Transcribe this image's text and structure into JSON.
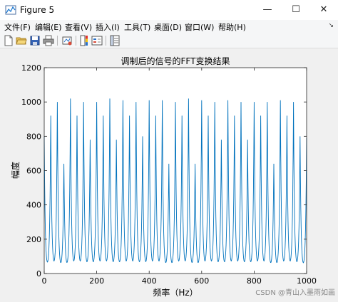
{
  "window": {
    "title": "Figure 5",
    "minimize": "—",
    "maximize": "☐",
    "close": "✕"
  },
  "menu": {
    "items": [
      {
        "label": "文件(F)"
      },
      {
        "label": "编辑(E)"
      },
      {
        "label": "查看(V)"
      },
      {
        "label": "插入(I)"
      },
      {
        "label": "工具(T)"
      },
      {
        "label": "桌面(D)"
      },
      {
        "label": "窗口(W)"
      },
      {
        "label": "帮助(H)"
      }
    ],
    "overflow_arrow": "↘"
  },
  "toolbar": {
    "icons": [
      "new-figure-icon",
      "open-file-icon",
      "save-icon",
      "print-icon",
      "link-plot-icon",
      "colorbar-icon",
      "legend-icon",
      "property-inspector-icon"
    ]
  },
  "chart_data": {
    "type": "line",
    "title": "调制后的信号的FFT变换结果",
    "xlabel": "频率（Hz）",
    "ylabel": "幅度",
    "xlim": [
      0,
      1000
    ],
    "ylim": [
      0,
      1200
    ],
    "xticks": [
      "0",
      "200",
      "400",
      "600",
      "800",
      "1000"
    ],
    "yticks": [
      "0",
      "200",
      "400",
      "600",
      "800",
      "1000",
      "1200"
    ],
    "grid": false,
    "line_color": "#0072bd",
    "peak_x": [
      0,
      25,
      50,
      75,
      100,
      125,
      150,
      175,
      200,
      225,
      250,
      275,
      300,
      325,
      350,
      375,
      400,
      425,
      450,
      475,
      500,
      525,
      550,
      575,
      600,
      625,
      650,
      675,
      700,
      725,
      750,
      775,
      800,
      825,
      850,
      875,
      900,
      925,
      950,
      975,
      1000
    ],
    "peak_y": [
      800,
      920,
      1000,
      640,
      1020,
      920,
      1000,
      780,
      1000,
      920,
      1020,
      780,
      1010,
      920,
      1000,
      800,
      1010,
      920,
      1010,
      640,
      1000,
      920,
      1020,
      640,
      1010,
      920,
      1000,
      780,
      1010,
      920,
      1000,
      780,
      1000,
      920,
      1000,
      640,
      1010,
      920,
      1000,
      800,
      790
    ],
    "valley_y": 15
  },
  "watermark": "CSDN @青山入墨雨如画"
}
